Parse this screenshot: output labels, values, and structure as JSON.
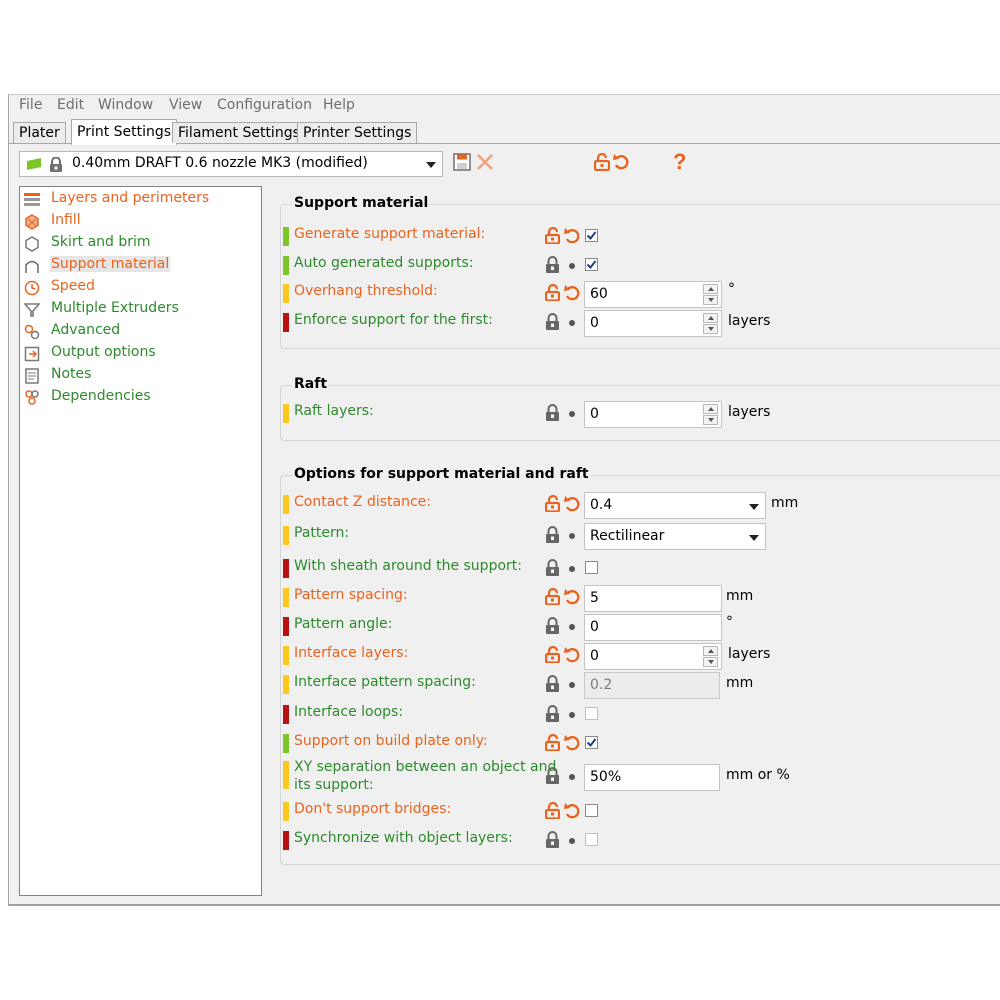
{
  "menu": [
    "File",
    "Edit",
    "Window",
    "View",
    "Configuration",
    "Help"
  ],
  "tabs": [
    "Plater",
    "Print Settings",
    "Filament Settings",
    "Printer Settings"
  ],
  "preset": {
    "name": "0.40mm DRAFT 0.6 nozzle MK3 (modified)"
  },
  "toolbar": {
    "help_label": "?"
  },
  "colors": {
    "green": "#2c8a2c",
    "orange": "#e8631e",
    "bar_green": "#7dc42b",
    "bar_yellow": "#fcc81f",
    "bar_red": "#b81213"
  },
  "tree": [
    {
      "label": "Layers and perimeters",
      "icon": "layers-icon",
      "color": "orange"
    },
    {
      "label": "Infill",
      "icon": "infill-icon",
      "color": "orange"
    },
    {
      "label": "Skirt and brim",
      "icon": "skirt-icon",
      "color": "green"
    },
    {
      "label": "Support material",
      "icon": "support-icon",
      "color": "orange",
      "selected": true
    },
    {
      "label": "Speed",
      "icon": "speed-icon",
      "color": "orange"
    },
    {
      "label": "Multiple Extruders",
      "icon": "extruder-icon",
      "color": "green"
    },
    {
      "label": "Advanced",
      "icon": "wrench-icon",
      "color": "green"
    },
    {
      "label": "Output options",
      "icon": "output-icon",
      "color": "green"
    },
    {
      "label": "Notes",
      "icon": "notes-icon",
      "color": "green"
    },
    {
      "label": "Dependencies",
      "icon": "dependencies-icon",
      "color": "green"
    }
  ],
  "groups": {
    "support": "Support material",
    "raft": "Raft",
    "options": "Options for support material and raft"
  },
  "rows": {
    "generate": {
      "label": "Generate support material:",
      "checked": true
    },
    "auto": {
      "label": "Auto generated supports:",
      "checked": true
    },
    "overhang": {
      "label": "Overhang threshold:",
      "value": "60",
      "unit": "°"
    },
    "enforce": {
      "label": "Enforce support for the first:",
      "value": "0",
      "unit": "layers"
    },
    "raft_layers": {
      "label": "Raft layers:",
      "value": "0",
      "unit": "layers"
    },
    "contact_z": {
      "label": "Contact Z distance:",
      "value": "0.4",
      "unit": "mm"
    },
    "pattern": {
      "label": "Pattern:",
      "value": "Rectilinear"
    },
    "sheath": {
      "label": "With sheath around the support:",
      "checked": false
    },
    "pattern_spacing": {
      "label": "Pattern spacing:",
      "value": "5",
      "unit": "mm"
    },
    "pattern_angle": {
      "label": "Pattern angle:",
      "value": "0",
      "unit": "°"
    },
    "interface_layers": {
      "label": "Interface layers:",
      "value": "0",
      "unit": "layers"
    },
    "interface_spacing": {
      "label": "Interface pattern spacing:",
      "value": "0.2",
      "unit": "mm"
    },
    "interface_loops": {
      "label": "Interface loops:",
      "checked": false
    },
    "build_plate": {
      "label": "Support on build plate only:",
      "checked": true
    },
    "xy_sep": {
      "label_line1": "XY separation between an object and",
      "label_line2": "its support:",
      "value": "50%",
      "unit": "mm or %"
    },
    "bridges": {
      "label": "Don't support bridges:",
      "checked": false
    },
    "sync": {
      "label": "Synchronize with object layers:",
      "checked": false
    }
  }
}
